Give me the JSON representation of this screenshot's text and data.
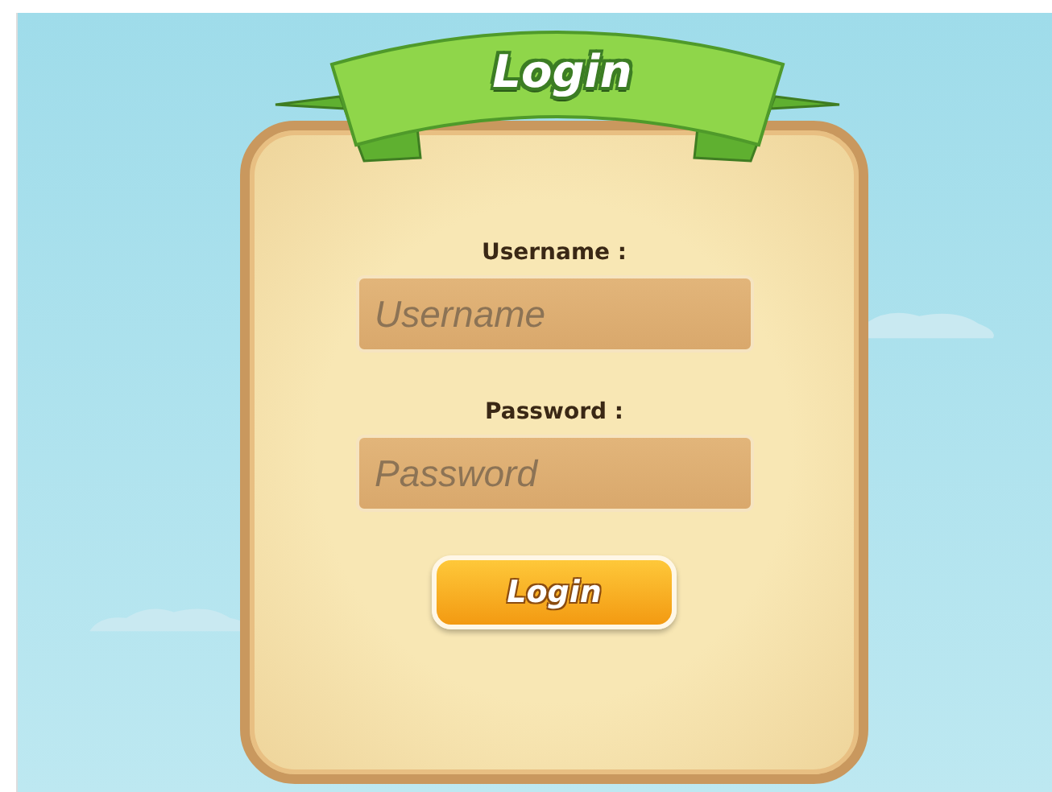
{
  "title": "Login",
  "fields": [
    {
      "label": "Username :",
      "placeholder": "Username"
    },
    {
      "label": "Password :",
      "placeholder": "Password"
    }
  ],
  "button": "Login"
}
